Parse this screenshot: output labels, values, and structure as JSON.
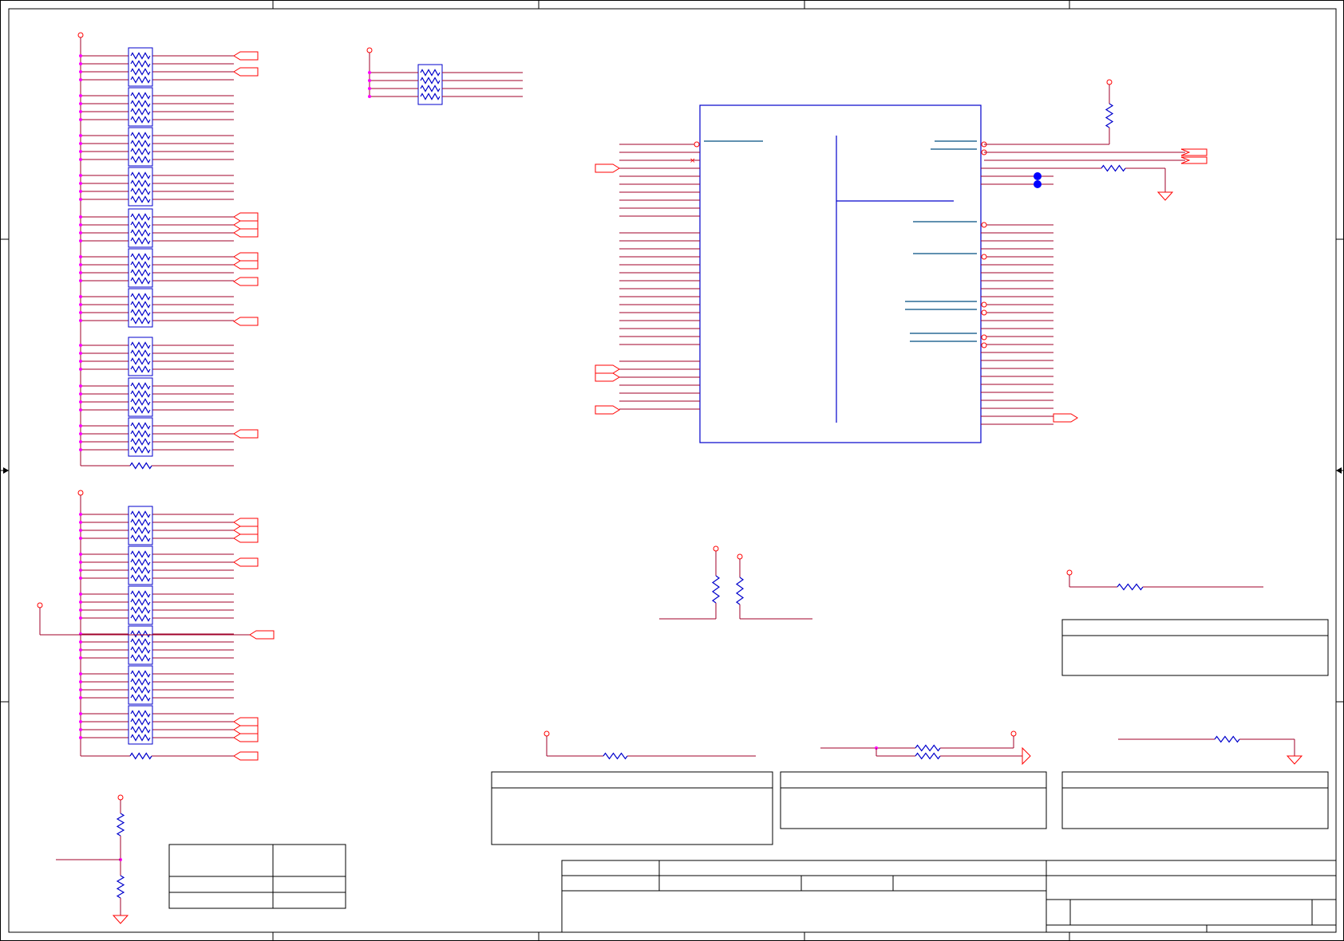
{
  "colors": {
    "frame": "#000000",
    "wire": "#a0002a",
    "net": "#ff0000",
    "component": "#0000cc",
    "junction": "#ff00ff",
    "pin_line": "#004d80",
    "dot": "#0000ff"
  },
  "icons": {
    "resistor": "zigzag-resistor-icon",
    "ground": "ground-triangle-icon",
    "power": "power-pin-circle-icon",
    "offpage": "offpage-connector-icon"
  },
  "text": {}
}
